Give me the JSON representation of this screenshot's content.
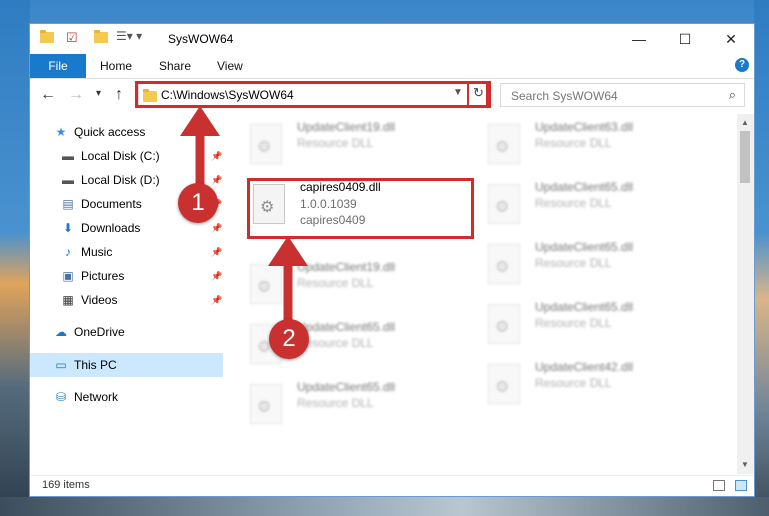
{
  "window": {
    "title": "SysWOW64",
    "minimize": "—",
    "maximize": "☐",
    "close": "✕"
  },
  "ribbon": {
    "file": "File",
    "tabs": [
      "Home",
      "Share",
      "View"
    ],
    "help": "?"
  },
  "nav": {
    "address": "C:\\Windows\\SysWOW64",
    "search_placeholder": "Search SysWOW64"
  },
  "sidebar": {
    "items": [
      {
        "label": "Quick access",
        "icon": "star-icon"
      },
      {
        "label": "Local Disk (C:)",
        "icon": "drive-icon",
        "pinned": true
      },
      {
        "label": "Local Disk (D:)",
        "icon": "drive-icon",
        "pinned": true
      },
      {
        "label": "Documents",
        "icon": "document-icon",
        "pinned": true
      },
      {
        "label": "Downloads",
        "icon": "download-icon",
        "pinned": true
      },
      {
        "label": "Music",
        "icon": "music-icon",
        "pinned": true
      },
      {
        "label": "Pictures",
        "icon": "pictures-icon",
        "pinned": true
      },
      {
        "label": "Videos",
        "icon": "videos-icon",
        "pinned": true
      },
      {
        "label": "OneDrive",
        "icon": "cloud-icon"
      },
      {
        "label": "This PC",
        "icon": "computer-icon",
        "selected": true
      },
      {
        "label": "Network",
        "icon": "network-icon"
      }
    ]
  },
  "files": {
    "left": [
      {
        "name": "UpdateClient19.dll",
        "sub1": "Resource DLL"
      },
      {
        "name": "capires0409.dll",
        "sub1": "1.0.0.1039",
        "sub2": "capires0409"
      },
      {
        "name": "UpdateClient19.dll",
        "sub1": "Resource DLL"
      },
      {
        "name": "UpdateClient65.dll",
        "sub1": "Resource DLL"
      },
      {
        "name": "UpdateClient65.dll",
        "sub1": "Resource DLL"
      }
    ],
    "right": [
      {
        "name": "UpdateClient63.dll",
        "sub1": "Resource DLL"
      },
      {
        "name": "UpdateClient65.dll",
        "sub1": "Resource DLL"
      },
      {
        "name": "UpdateClient65.dll",
        "sub1": "Resource DLL"
      },
      {
        "name": "UpdateClient65.dll",
        "sub1": "Resource DLL"
      },
      {
        "name": "UpdateClient42.dll",
        "sub1": "Resource DLL"
      }
    ]
  },
  "status": {
    "items": "169 items"
  },
  "annotations": {
    "step1": "1",
    "step2": "2"
  },
  "colors": {
    "accent": "#1979ca",
    "highlight": "#d12b2b",
    "selected": "#cce8ff"
  }
}
